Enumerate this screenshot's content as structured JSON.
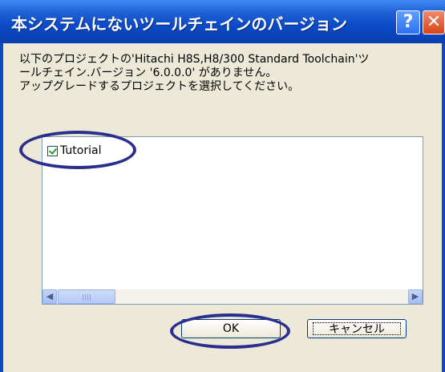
{
  "dialog": {
    "title": "本システムにないツールチェインのバージョン",
    "help_icon": "?",
    "close_icon": "✕"
  },
  "message": {
    "line1": "以下のプロジェクトの'Hitachi H8S,H8/300 Standard Toolchain'ツ",
    "line2": "ールチェイン.バージョン '6.0.0.0' がありません。",
    "line3": "アップグレードするプロジェクトを選択してください。"
  },
  "projects": {
    "items": [
      {
        "label": "Tutorial",
        "checked": true
      }
    ]
  },
  "scrollbar": {
    "left_icon": "◀",
    "right_icon": "▶"
  },
  "buttons": {
    "ok": "OK",
    "cancel": "キャンセル"
  },
  "annotation": {
    "color": "#2a2f8e"
  }
}
